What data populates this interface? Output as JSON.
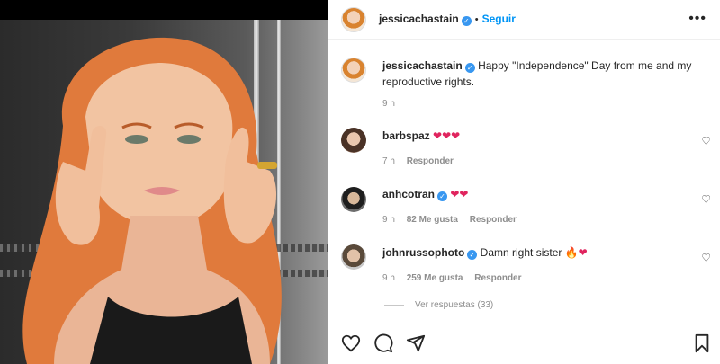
{
  "header": {
    "username": "jessicachastain",
    "separator": "•",
    "follow_label": "Seguir",
    "more_icon": "more-horizontal-icon"
  },
  "caption": {
    "username": "jessicachastain",
    "text": "Happy \"Independence\" Day from me and my reproductive rights.",
    "time": "9 h"
  },
  "comments": [
    {
      "username": "barbspaz",
      "text": "",
      "emoji": "❤❤❤",
      "time": "7 h",
      "likes": "",
      "reply_label": "Responder",
      "verified": false
    },
    {
      "username": "anhcotran",
      "text": "",
      "emoji": "❤❤",
      "time": "9 h",
      "likes": "82 Me gusta",
      "reply_label": "Responder",
      "verified": true
    },
    {
      "username": "johnrussophoto",
      "text": "Damn right sister ",
      "emoji": "🔥❤",
      "time": "9 h",
      "likes": "259 Me gusta",
      "reply_label": "Responder",
      "verified": true
    }
  ],
  "replies": {
    "label": "Ver respuestas (33)"
  },
  "actions": [
    "heart-icon",
    "comment-icon",
    "share-icon",
    "bookmark-icon"
  ],
  "colors": {
    "accent": "#0095f6",
    "verified": "#3897f0",
    "heart_red": "#e0245e",
    "muted": "#8e8e8e"
  }
}
